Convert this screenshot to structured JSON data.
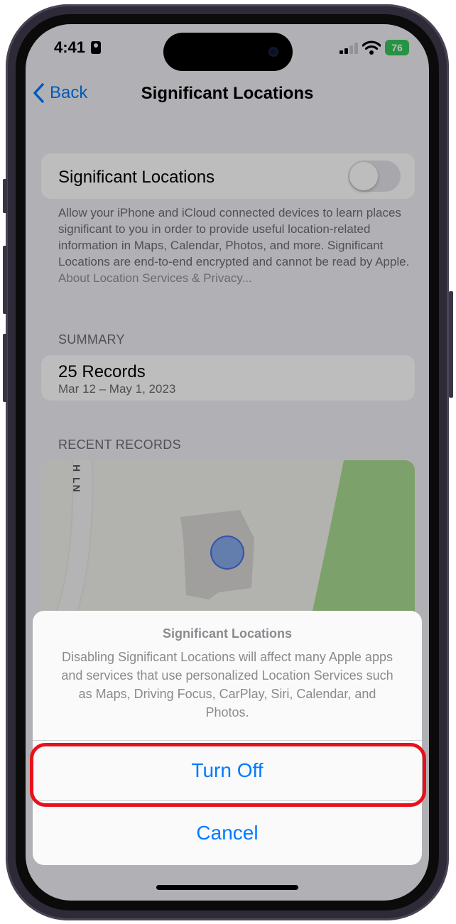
{
  "status": {
    "time": "4:41",
    "battery": "76"
  },
  "nav": {
    "back_label": "Back",
    "title": "Significant Locations"
  },
  "toggle_row": {
    "label": "Significant Locations",
    "on": false
  },
  "description": {
    "text": "Allow your iPhone and iCloud connected devices to learn places significant to you in order to provide useful location-related information in Maps, Calendar, Photos, and more. Significant Locations are end-to-end encrypted and cannot be read by Apple.",
    "link": "About Location Services & Privacy..."
  },
  "summary": {
    "header": "SUMMARY",
    "title": "25 Records",
    "subtitle": "Mar 12 – May 1, 2023"
  },
  "recent": {
    "header": "RECENT RECORDS",
    "map_street_label": "H LN"
  },
  "sheet": {
    "title": "Significant Locations",
    "message": "Disabling Significant Locations will affect many Apple apps and services that use personalized Location Services such as Maps, Driving Focus, CarPlay, Siri, Calendar, and Photos.",
    "turn_off": "Turn Off",
    "cancel": "Cancel"
  },
  "colors": {
    "accent": "#007aff",
    "highlight": "#e8111b",
    "battery": "#34c759",
    "map_green": "#a9d98f"
  }
}
